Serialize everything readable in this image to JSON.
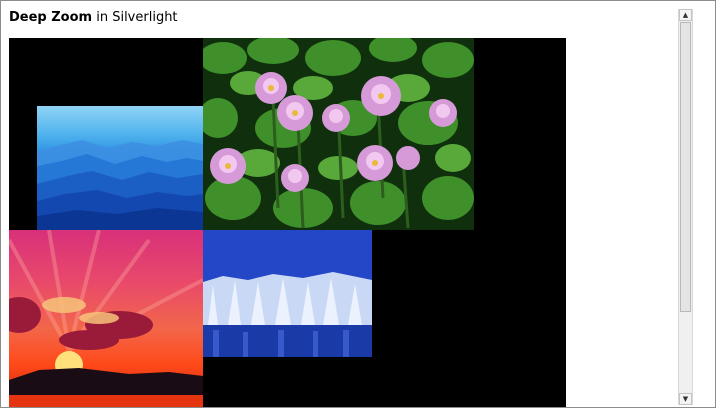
{
  "header": {
    "title_bold": "Deep Zoom",
    "title_rest": " in Silverlight"
  },
  "deep_zoom": {
    "images": [
      {
        "name": "mountains"
      },
      {
        "name": "water-lilies"
      },
      {
        "name": "sunset"
      },
      {
        "name": "frosted-forest"
      }
    ]
  },
  "scrollbar": {
    "up_icon": "arrow-up-icon",
    "down_icon": "arrow-down-icon"
  }
}
